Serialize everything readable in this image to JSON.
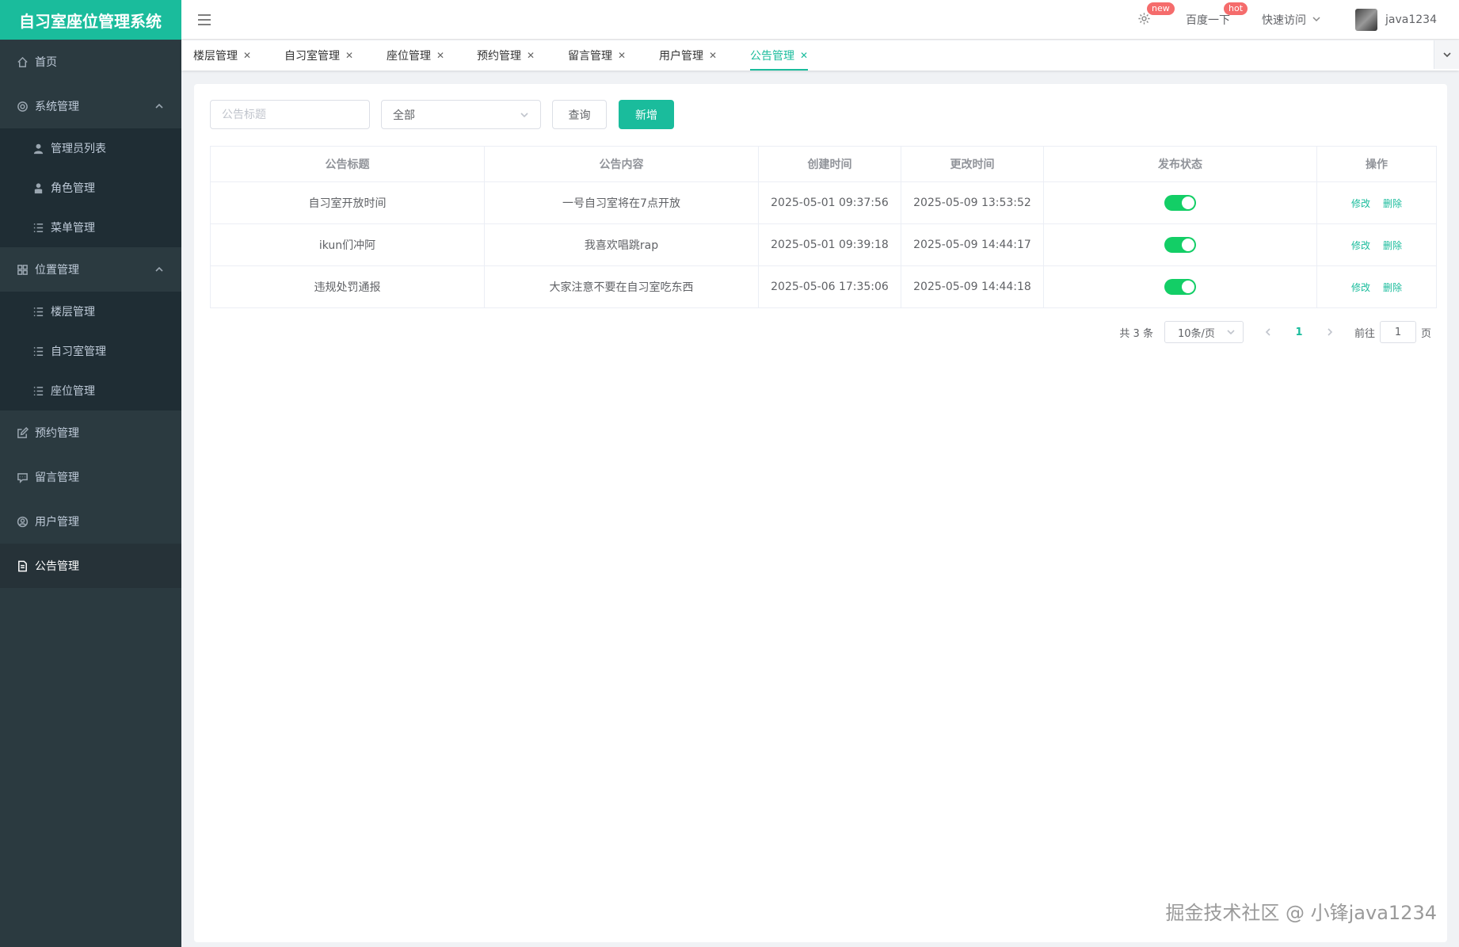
{
  "app": {
    "title": "自习室座位管理系统"
  },
  "sidebar": {
    "home": "首页",
    "system": {
      "label": "系统管理",
      "items": [
        "管理员列表",
        "角色管理",
        "菜单管理"
      ]
    },
    "location": {
      "label": "位置管理",
      "items": [
        "楼层管理",
        "自习室管理",
        "座位管理"
      ]
    },
    "booking": "预约管理",
    "message": "留言管理",
    "user": "用户管理",
    "notice": "公告管理"
  },
  "header": {
    "badge_new": "new",
    "baidu": "百度一下",
    "badge_hot": "hot",
    "quick": "快速访问",
    "username": "java1234"
  },
  "tabs": [
    "楼层管理",
    "自习室管理",
    "座位管理",
    "预约管理",
    "留言管理",
    "用户管理",
    "公告管理"
  ],
  "toolbar": {
    "title_placeholder": "公告标题",
    "select_value": "全部",
    "query_label": "查询",
    "add_label": "新增"
  },
  "table": {
    "headers": [
      "公告标题",
      "公告内容",
      "创建时间",
      "更改时间",
      "发布状态",
      "操作"
    ],
    "rows": [
      {
        "title": "自习室开放时间",
        "content": "一号自习室将在7点开放",
        "created": "2025-05-01 09:37:56",
        "updated": "2025-05-09 13:53:52",
        "published": true
      },
      {
        "title": "ikun们冲阿",
        "content": "我喜欢唱跳rap",
        "created": "2025-05-01 09:39:18",
        "updated": "2025-05-09 14:44:17",
        "published": true
      },
      {
        "title": "违规处罚通报",
        "content": "大家注意不要在自习室吃东西",
        "created": "2025-05-06 17:35:06",
        "updated": "2025-05-09 14:44:18",
        "published": true
      }
    ],
    "edit_label": "修改",
    "delete_label": "删除"
  },
  "pager": {
    "total": "共 3 条",
    "page_size": "10条/页",
    "current": "1",
    "goto_prefix": "前往",
    "goto_value": "1",
    "goto_suffix": "页"
  },
  "watermark": "掘金技术社区 @ 小锋java1234",
  "colors": {
    "accent": "#1abc9c",
    "sidebar": "#2b3a40",
    "switch_on": "#13ce66",
    "badge": "#f56c6c"
  }
}
